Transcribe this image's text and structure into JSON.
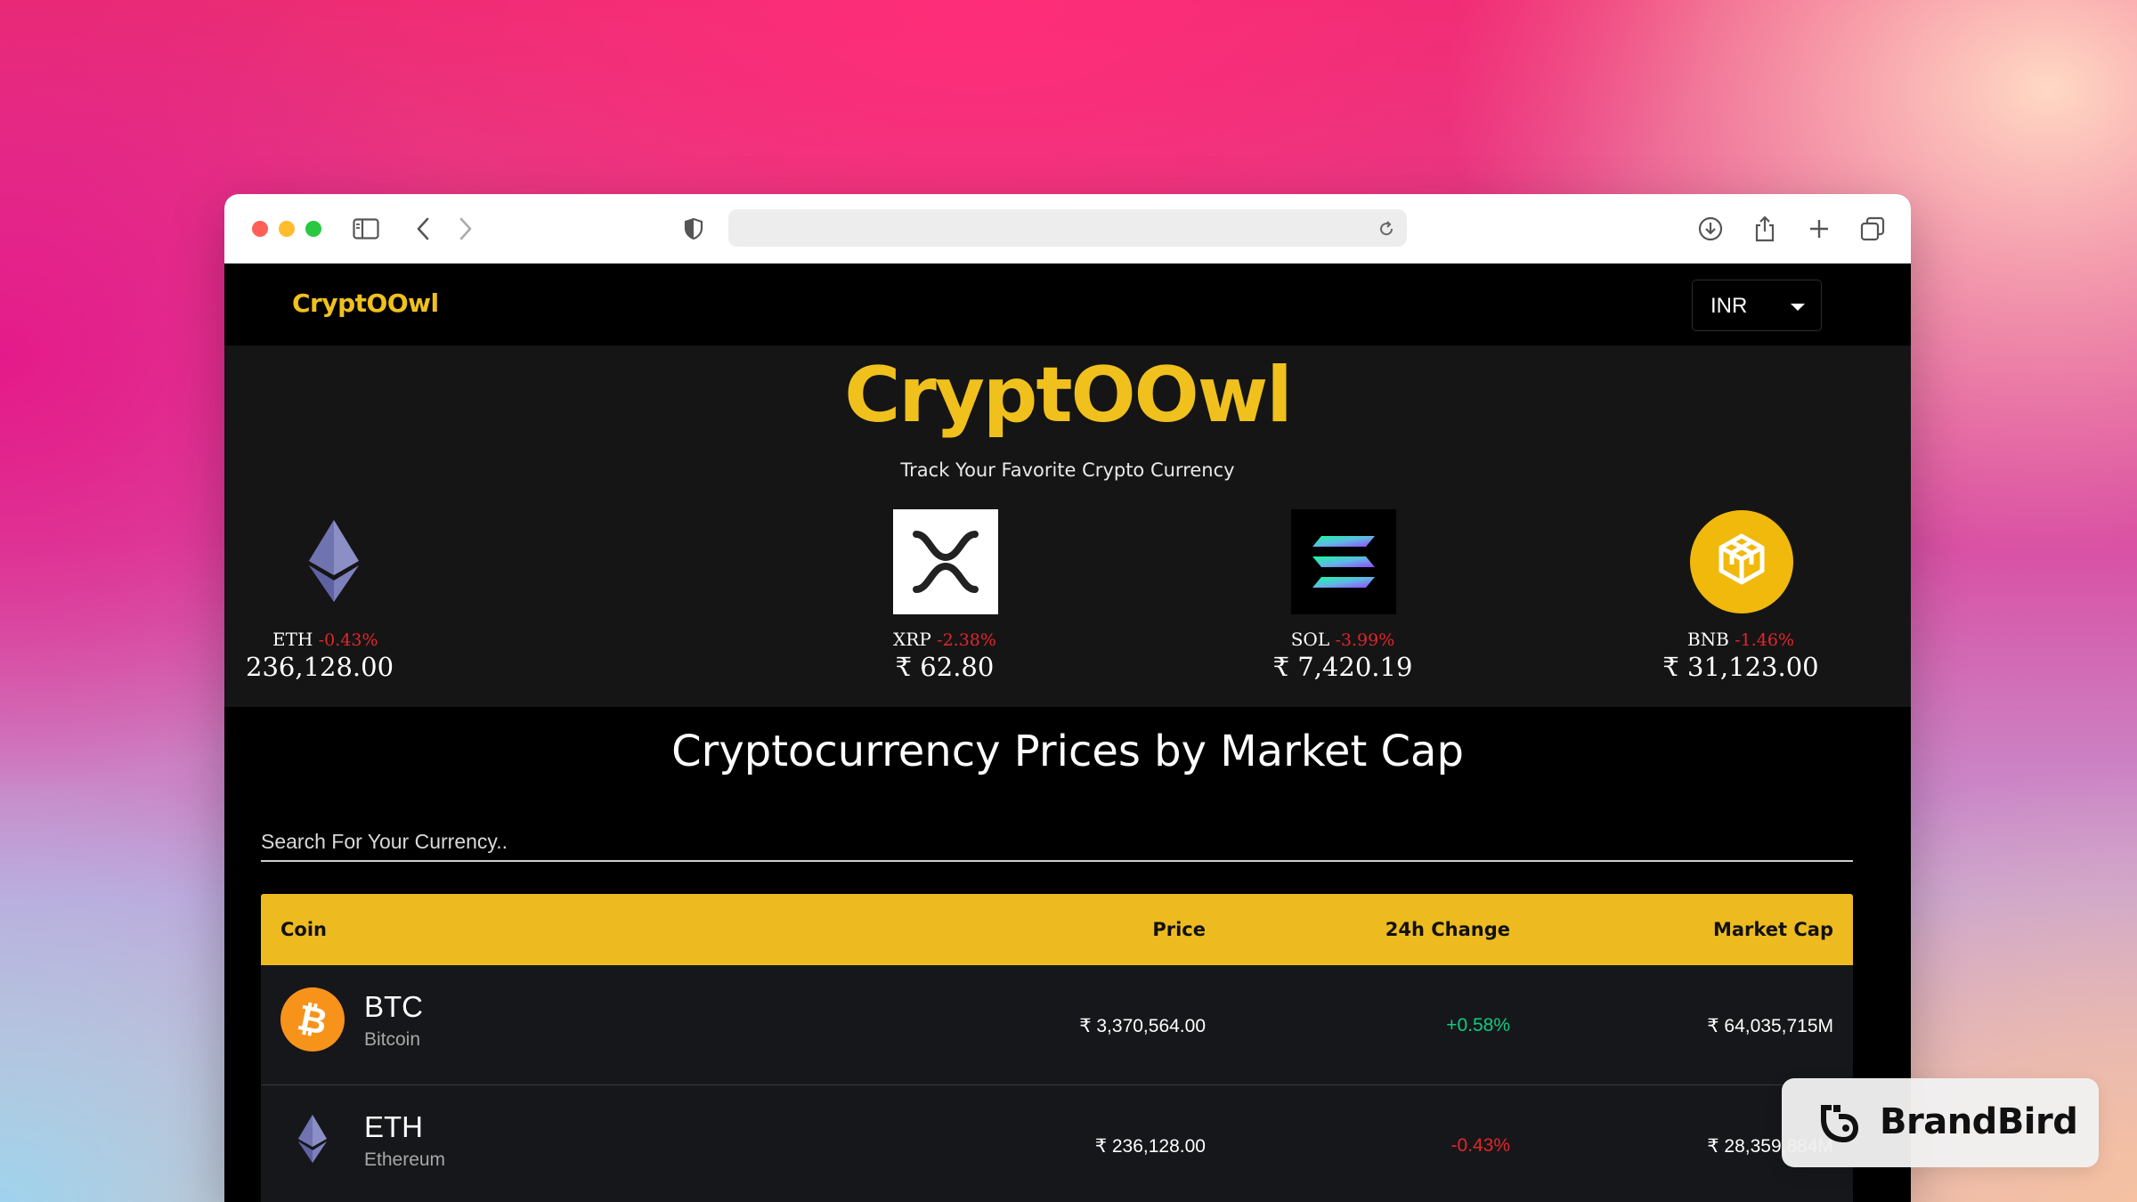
{
  "app": {
    "brand": "CryptOOwl",
    "currency": "INR",
    "hero_title": "CryptOOwl",
    "hero_subtitle": "Track Your Favorite Crypto Currency"
  },
  "carousel": [
    {
      "symbol": "ETH",
      "change": "-0.43%",
      "price": "236,128.00",
      "icon": "ethereum-icon"
    },
    {
      "symbol": "XRP",
      "change": "-2.38%",
      "price": "₹ 62.80",
      "icon": "xrp-icon"
    },
    {
      "symbol": "SOL",
      "change": "-3.99%",
      "price": "₹ 7,420.19",
      "icon": "solana-icon"
    },
    {
      "symbol": "BNB",
      "change": "-1.46%",
      "price": "₹ 31,123.00",
      "icon": "bnb-icon"
    }
  ],
  "section_title": "Cryptocurrency Prices by Market Cap",
  "search": {
    "placeholder": "Search For Your Currency.."
  },
  "table": {
    "headers": {
      "coin": "Coin",
      "price": "Price",
      "change": "24h Change",
      "market_cap": "Market Cap"
    },
    "rows": [
      {
        "symbol": "BTC",
        "name": "Bitcoin",
        "price": "₹ 3,370,564.00",
        "change": "+0.58%",
        "market_cap": "₹ 64,035,715M",
        "icon": "bitcoin-icon"
      },
      {
        "symbol": "ETH",
        "name": "Ethereum",
        "price": "₹ 236,128.00",
        "change": "-0.43%",
        "market_cap": "₹ 28,359,884M",
        "icon": "ethereum-icon"
      }
    ]
  },
  "watermark": {
    "label": "BrandBird"
  },
  "colors": {
    "accent": "#f0c11c",
    "header": "#edbb1f",
    "positive": "#0ecb81",
    "negative": "#e3252a"
  }
}
